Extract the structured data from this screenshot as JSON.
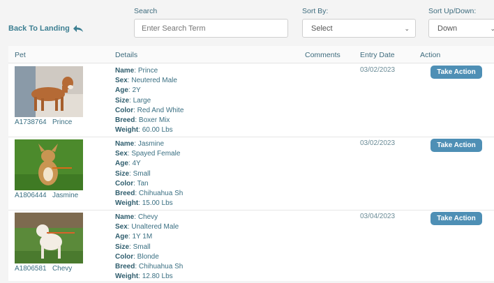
{
  "header": {
    "search_label": "Search",
    "sort_by_label": "Sort By:",
    "sort_dir_label": "Sort Up/Down:",
    "back_label": "Back To Landing",
    "search_placeholder": "Enter Search Term",
    "sort_by_value": "Select",
    "sort_dir_value": "Down"
  },
  "table": {
    "columns": [
      "Pet",
      "Details",
      "Comments",
      "Entry Date",
      "Action"
    ],
    "field_labels": [
      "Name",
      "Sex",
      "Age",
      "Size",
      "Color",
      "Breed",
      "Weight"
    ],
    "action_label": "Take Action",
    "rows": [
      {
        "id": "A1738764",
        "name": "Prince",
        "sex": "Neutered Male",
        "age": "2Y",
        "size": "Large",
        "color": "Red And White",
        "breed": "Boxer Mix",
        "weight": "60.00 Lbs",
        "comments": "",
        "entry_date": "03/02/2023"
      },
      {
        "id": "A1806444",
        "name": "Jasmine",
        "sex": "Spayed Female",
        "age": "4Y",
        "size": "Small",
        "color": "Tan",
        "breed": "Chihuahua Sh",
        "weight": "15.00 Lbs",
        "comments": "",
        "entry_date": "03/02/2023"
      },
      {
        "id": "A1806581",
        "name": "Chevy",
        "sex": "Unaltered Male",
        "age": "1Y 1M",
        "size": "Small",
        "color": "Blonde",
        "breed": "Chihuahua Sh",
        "weight": "12.80 Lbs",
        "comments": "",
        "entry_date": "03/04/2023"
      }
    ]
  },
  "colors": {
    "accent": "#4e8fb5",
    "text": "#3a6f82"
  }
}
